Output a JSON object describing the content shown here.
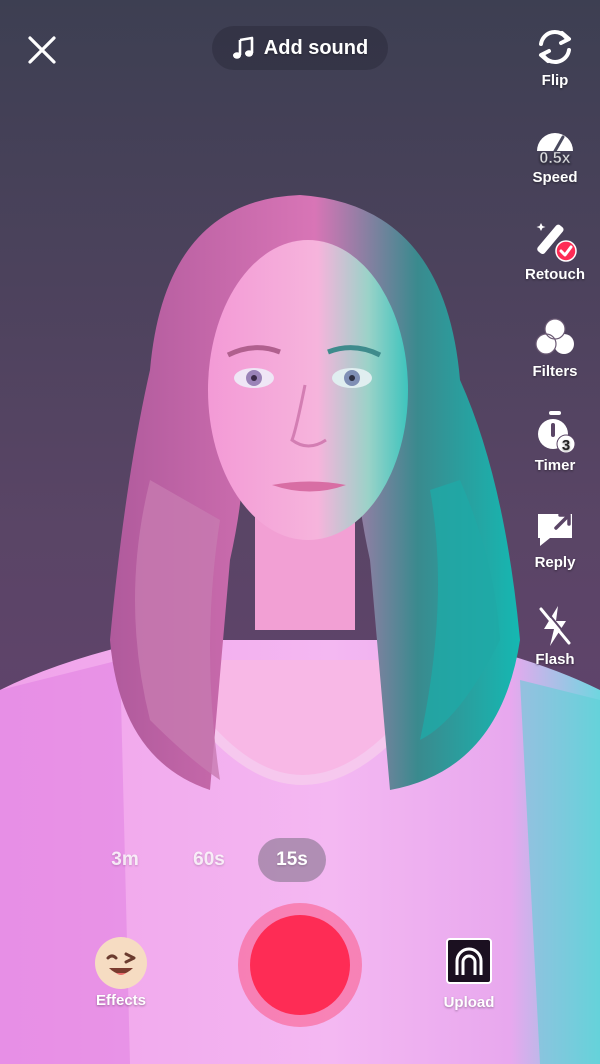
{
  "header": {
    "close_icon": "close-icon",
    "add_sound_label": "Add sound",
    "music_icon": "music-note-icon"
  },
  "right_toolbar": [
    {
      "id": "flip",
      "label": "Flip",
      "icon": "flip-camera-icon"
    },
    {
      "id": "speed",
      "label": "Speed",
      "icon": "speed-gauge-icon",
      "value": "0.5x"
    },
    {
      "id": "retouch",
      "label": "Retouch",
      "icon": "magic-wand-icon",
      "badge_color": "#fe2c55"
    },
    {
      "id": "filters",
      "label": "Filters",
      "icon": "filters-circles-icon"
    },
    {
      "id": "timer",
      "label": "Timer",
      "icon": "timer-icon",
      "value": "3"
    },
    {
      "id": "reply",
      "label": "Reply",
      "icon": "reply-icon"
    },
    {
      "id": "flash",
      "label": "Flash",
      "icon": "flash-off-icon"
    }
  ],
  "durations": [
    {
      "label": "3m",
      "selected": false
    },
    {
      "label": "60s",
      "selected": false
    },
    {
      "label": "15s",
      "selected": true
    }
  ],
  "bottom": {
    "effects_label": "Effects",
    "effects_icon": "winking-face-icon",
    "upload_label": "Upload",
    "upload_icon": "gallery-thumbnail-icon",
    "record_icon": "record-button"
  },
  "colors": {
    "record": "#fe2c55",
    "accent_pink": "#ff5fd8",
    "accent_teal": "#12c8c2"
  }
}
